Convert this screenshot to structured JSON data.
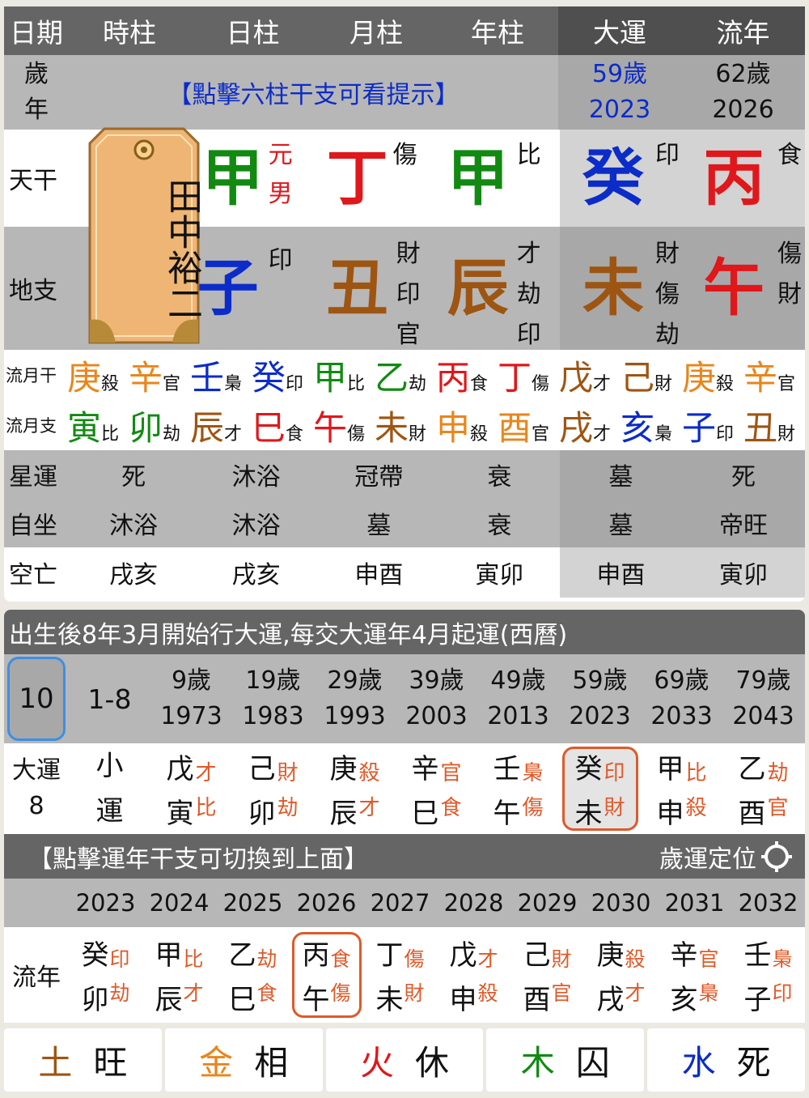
{
  "colors": {
    "blue": "#0b2cc9",
    "green": "#128a12",
    "red": "#e0171b",
    "brown": "#9e5512",
    "orange": "#e8861c",
    "accent": "#de5a2a",
    "select_blue": "#3d8fe3"
  },
  "header": {
    "cols": [
      "日期",
      "時柱",
      "日柱",
      "月柱",
      "年柱",
      "大運",
      "流年"
    ]
  },
  "age_row": {
    "label_top": "歲",
    "label_bottom": "年",
    "hint": "【點擊六柱干支可看提示】",
    "dayun_age": "59歲",
    "dayun_year": "2023",
    "liunian_age": "62歲",
    "liunian_year": "2026"
  },
  "name_tag": {
    "name": "田中裕二"
  },
  "tiangan": {
    "label": "天干",
    "day": "甲",
    "day_mark1": "元",
    "day_mark2": "男",
    "month": "丁",
    "month_god": "傷",
    "year": "甲",
    "year_god": "比",
    "dayun": "癸",
    "dayun_god": "印",
    "liunian": "丙",
    "liunian_god": "食"
  },
  "dizhi": {
    "label": "地支",
    "day": "子",
    "day_hidden": [
      "印"
    ],
    "month": "丑",
    "month_hidden": [
      "財",
      "印",
      "官"
    ],
    "year": "辰",
    "year_hidden": [
      "才",
      "劫",
      "印"
    ],
    "dayun": "未",
    "dayun_hidden": [
      "財",
      "傷",
      "劫"
    ],
    "liunian": "午",
    "liunian_hidden": [
      "傷",
      "財"
    ]
  },
  "flow_month_stem": {
    "label": "流月干",
    "items": [
      {
        "c": "庚",
        "g": "殺",
        "col": "orange"
      },
      {
        "c": "辛",
        "g": "官",
        "col": "orange"
      },
      {
        "c": "壬",
        "g": "梟",
        "col": "blue"
      },
      {
        "c": "癸",
        "g": "印",
        "col": "blue"
      },
      {
        "c": "甲",
        "g": "比",
        "col": "green"
      },
      {
        "c": "乙",
        "g": "劫",
        "col": "green"
      },
      {
        "c": "丙",
        "g": "食",
        "col": "red"
      },
      {
        "c": "丁",
        "g": "傷",
        "col": "red"
      },
      {
        "c": "戊",
        "g": "才",
        "col": "brown"
      },
      {
        "c": "己",
        "g": "財",
        "col": "brown"
      },
      {
        "c": "庚",
        "g": "殺",
        "col": "orange"
      },
      {
        "c": "辛",
        "g": "官",
        "col": "orange"
      }
    ]
  },
  "flow_month_branch": {
    "label": "流月支",
    "items": [
      {
        "c": "寅",
        "g": "比",
        "col": "green"
      },
      {
        "c": "卯",
        "g": "劫",
        "col": "green"
      },
      {
        "c": "辰",
        "g": "才",
        "col": "brown"
      },
      {
        "c": "巳",
        "g": "食",
        "col": "red"
      },
      {
        "c": "午",
        "g": "傷",
        "col": "red"
      },
      {
        "c": "未",
        "g": "財",
        "col": "brown"
      },
      {
        "c": "申",
        "g": "殺",
        "col": "orange"
      },
      {
        "c": "酉",
        "g": "官",
        "col": "orange"
      },
      {
        "c": "戌",
        "g": "才",
        "col": "brown"
      },
      {
        "c": "亥",
        "g": "梟",
        "col": "blue"
      },
      {
        "c": "子",
        "g": "印",
        "col": "blue"
      },
      {
        "c": "丑",
        "g": "財",
        "col": "brown"
      }
    ]
  },
  "xingyun": {
    "label": "星運",
    "values": [
      "死",
      "沐浴",
      "冠帶",
      "衰",
      "墓",
      "死"
    ]
  },
  "zizuo": {
    "label": "自坐",
    "values": [
      "沐浴",
      "沐浴",
      "墓",
      "衰",
      "墓",
      "帝旺"
    ]
  },
  "kongwang": {
    "label": "空亡",
    "values": [
      "戌亥",
      "戌亥",
      "申酉",
      "寅卯",
      "申酉",
      "寅卯"
    ]
  },
  "dayun_section": {
    "title": "出生後8年3月開始行大運,每交大運年4月起運(西曆)",
    "selector": "10",
    "first": "1-8",
    "label_top": "大運",
    "label_num": "8",
    "small_top": "小",
    "small_bottom": "運",
    "periods": [
      {
        "age": "9歲",
        "year": "1973",
        "stem": "戊",
        "sg": "才",
        "branch": "寅",
        "bg": "比"
      },
      {
        "age": "19歲",
        "year": "1983",
        "stem": "己",
        "sg": "財",
        "branch": "卯",
        "bg": "劫"
      },
      {
        "age": "29歲",
        "year": "1993",
        "stem": "庚",
        "sg": "殺",
        "branch": "辰",
        "bg": "才"
      },
      {
        "age": "39歲",
        "year": "2003",
        "stem": "辛",
        "sg": "官",
        "branch": "巳",
        "bg": "食"
      },
      {
        "age": "49歲",
        "year": "2013",
        "stem": "壬",
        "sg": "梟",
        "branch": "午",
        "bg": "傷"
      },
      {
        "age": "59歲",
        "year": "2023",
        "stem": "癸",
        "sg": "印",
        "branch": "未",
        "bg": "財"
      },
      {
        "age": "69歲",
        "year": "2033",
        "stem": "甲",
        "sg": "比",
        "branch": "申",
        "bg": "殺"
      },
      {
        "age": "79歲",
        "year": "2043",
        "stem": "乙",
        "sg": "劫",
        "branch": "酉",
        "bg": "官"
      }
    ],
    "selected_index": 5
  },
  "liunian_section": {
    "title": "【點擊運年干支可切換到上面】",
    "locate_label": "歲運定位",
    "label": "流年",
    "years": [
      {
        "year": "2023",
        "stem": "癸",
        "sg": "印",
        "branch": "卯",
        "bg": "劫"
      },
      {
        "year": "2024",
        "stem": "甲",
        "sg": "比",
        "branch": "辰",
        "bg": "才"
      },
      {
        "year": "2025",
        "stem": "乙",
        "sg": "劫",
        "branch": "巳",
        "bg": "食"
      },
      {
        "year": "2026",
        "stem": "丙",
        "sg": "食",
        "branch": "午",
        "bg": "傷"
      },
      {
        "year": "2027",
        "stem": "丁",
        "sg": "傷",
        "branch": "未",
        "bg": "財"
      },
      {
        "year": "2028",
        "stem": "戊",
        "sg": "才",
        "branch": "申",
        "bg": "殺"
      },
      {
        "year": "2029",
        "stem": "己",
        "sg": "財",
        "branch": "酉",
        "bg": "官"
      },
      {
        "year": "2030",
        "stem": "庚",
        "sg": "殺",
        "branch": "戌",
        "bg": "才"
      },
      {
        "year": "2031",
        "stem": "辛",
        "sg": "官",
        "branch": "亥",
        "bg": "梟"
      },
      {
        "year": "2032",
        "stem": "壬",
        "sg": "梟",
        "branch": "子",
        "bg": "印"
      }
    ],
    "selected_index": 3
  },
  "elements": [
    {
      "el": "土",
      "state": "旺",
      "col": "brown"
    },
    {
      "el": "金",
      "state": "相",
      "col": "orange"
    },
    {
      "el": "火",
      "state": "休",
      "col": "red"
    },
    {
      "el": "木",
      "state": "囚",
      "col": "green"
    },
    {
      "el": "水",
      "state": "死",
      "col": "blue"
    }
  ]
}
